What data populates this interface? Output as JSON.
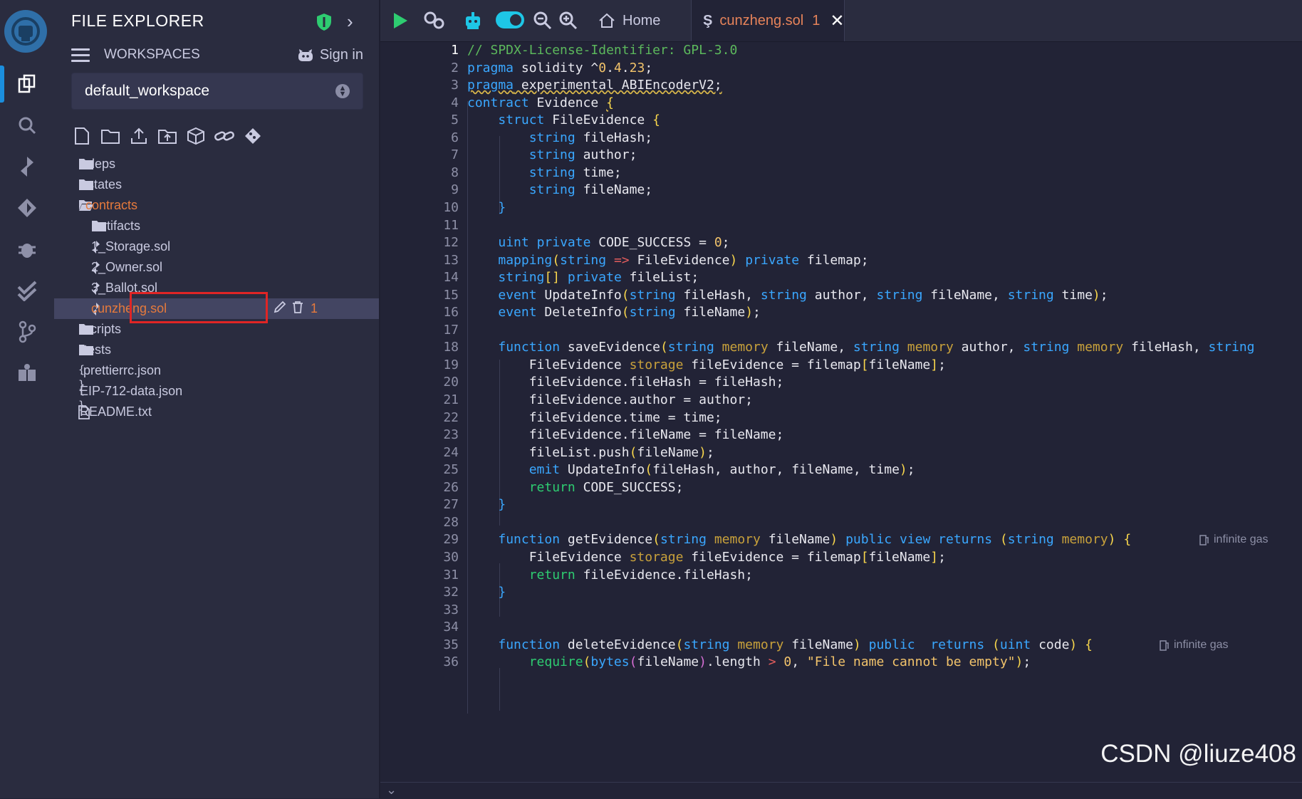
{
  "explorer": {
    "title": "FILE EXPLORER",
    "workspaces_label": "WORKSPACES",
    "sign_in": "Sign in",
    "workspace_selected": "default_workspace",
    "tree": [
      {
        "name": ".deps",
        "type": "folder",
        "indent": 0
      },
      {
        "name": ".states",
        "type": "folder",
        "indent": 0
      },
      {
        "name": "contracts",
        "type": "folder-open",
        "indent": 0
      },
      {
        "name": "artifacts",
        "type": "folder",
        "indent": 1
      },
      {
        "name": "1_Storage.sol",
        "type": "sol",
        "indent": 1
      },
      {
        "name": "2_Owner.sol",
        "type": "sol",
        "indent": 1
      },
      {
        "name": "3_Ballot.sol",
        "type": "sol",
        "indent": 1
      },
      {
        "name": "cunzheng.sol",
        "type": "sol",
        "indent": 1,
        "selected": true,
        "badge": "1"
      },
      {
        "name": "scripts",
        "type": "folder",
        "indent": 0
      },
      {
        "name": "tests",
        "type": "folder",
        "indent": 0
      },
      {
        "name": ".prettierrc.json",
        "type": "json",
        "indent": 0
      },
      {
        "name": "EIP-712-data.json",
        "type": "json",
        "indent": 0
      },
      {
        "name": "README.txt",
        "type": "txt",
        "indent": 0
      }
    ]
  },
  "tabs": {
    "home": "Home",
    "file": "cunzheng.sol",
    "file_badge": "1"
  },
  "editor": {
    "active_line": 1,
    "lines": [
      "// SPDX-License-Identifier: GPL-3.0",
      "pragma solidity ^0.4.23;",
      "pragma experimental ABIEncoderV2;",
      "contract Evidence {",
      "    struct FileEvidence {",
      "        string fileHash;",
      "        string author;",
      "        string time;",
      "        string fileName;",
      "    }",
      "",
      "    uint private CODE_SUCCESS = 0;",
      "    mapping(string => FileEvidence) private filemap;",
      "    string[] private fileList;",
      "    event UpdateInfo(string fileHash, string author, string fileName, string time);",
      "    event DeleteInfo(string fileName);",
      "",
      "    function saveEvidence(string memory fileName, string memory author, string memory fileHash, string",
      "        FileEvidence storage fileEvidence = filemap[fileName];",
      "        fileEvidence.fileHash = fileHash;",
      "        fileEvidence.author = author;",
      "        fileEvidence.time = time;",
      "        fileEvidence.fileName = fileName;",
      "        fileList.push(fileName);",
      "        emit UpdateInfo(fileHash, author, fileName, time);",
      "        return CODE_SUCCESS;",
      "    }",
      "",
      "    function getEvidence(string memory fileName) public view returns (string memory) {",
      "        FileEvidence storage fileEvidence = filemap[fileName];",
      "        return fileEvidence.fileHash;",
      "    }",
      "",
      "",
      "    function deleteEvidence(string memory fileName) public  returns (uint code) {",
      "        require(bytes(fileName).length > 0, \"File name cannot be empty\");"
    ],
    "gas_hints": [
      {
        "line": 29,
        "text": "infinite gas"
      },
      {
        "line": 35,
        "text": "infinite gas"
      }
    ]
  },
  "watermark": "CSDN @liuze408",
  "colors": {
    "accent": "#1b8edd",
    "selected_file": "#e67a3c",
    "highlight_box": "#e02525"
  }
}
